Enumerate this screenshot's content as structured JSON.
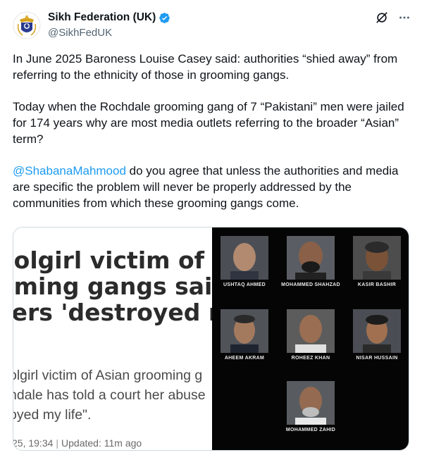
{
  "author": {
    "display_name": "Sikh Federation (UK)",
    "handle": "@SikhFedUK",
    "verified": true
  },
  "icons": {
    "avatar": "sikh-federation-crest-icon",
    "verified": "verified-badge-icon",
    "grok": "grok-icon",
    "more": "more-options-icon"
  },
  "tweet": {
    "paragraph1": "In June 2025 Baroness Louise Casey said: authorities “shied away” from referring to the ethnicity of those in grooming gangs.",
    "paragraph2": "Today when the Rochdale grooming gang of 7 “Pakistani” men were jailed for 174 years why are most media outlets referring to the broader “Asian” term?",
    "mention": "@ShabanaMahmood",
    "paragraph3_rest": " do you agree that unless the authorities and media are specific the problem will never be properly addressed by the communities from which these grooming gangs come."
  },
  "article": {
    "headline_line1": "oolgirl victim of Asi",
    "headline_line2": "oming gangs said",
    "headline_line3": "sers 'destroyed my",
    "summary_line1": "olgirl victim of Asian grooming g",
    "summary_line2": "ndale has told a court her abuse",
    "summary_line3": "oyed my life\".",
    "date": "25, 19:34",
    "updated": "Updated: 11m ago"
  },
  "mugshots": [
    {
      "name": "USHTAQ AHMED"
    },
    {
      "name": "MOHAMMED SHAHZAD"
    },
    {
      "name": "KASIR BASHIR"
    },
    {
      "name": "AHEEM AKRAM"
    },
    {
      "name": "ROHEEZ KHAN"
    },
    {
      "name": "NISAR HUSSAIN"
    },
    {
      "name": "MOHAMMED ZAHID"
    }
  ],
  "colors": {
    "link": "#1d9bf0",
    "verified": "#1d9bf0",
    "text": "#0f1419",
    "secondary": "#536471"
  }
}
